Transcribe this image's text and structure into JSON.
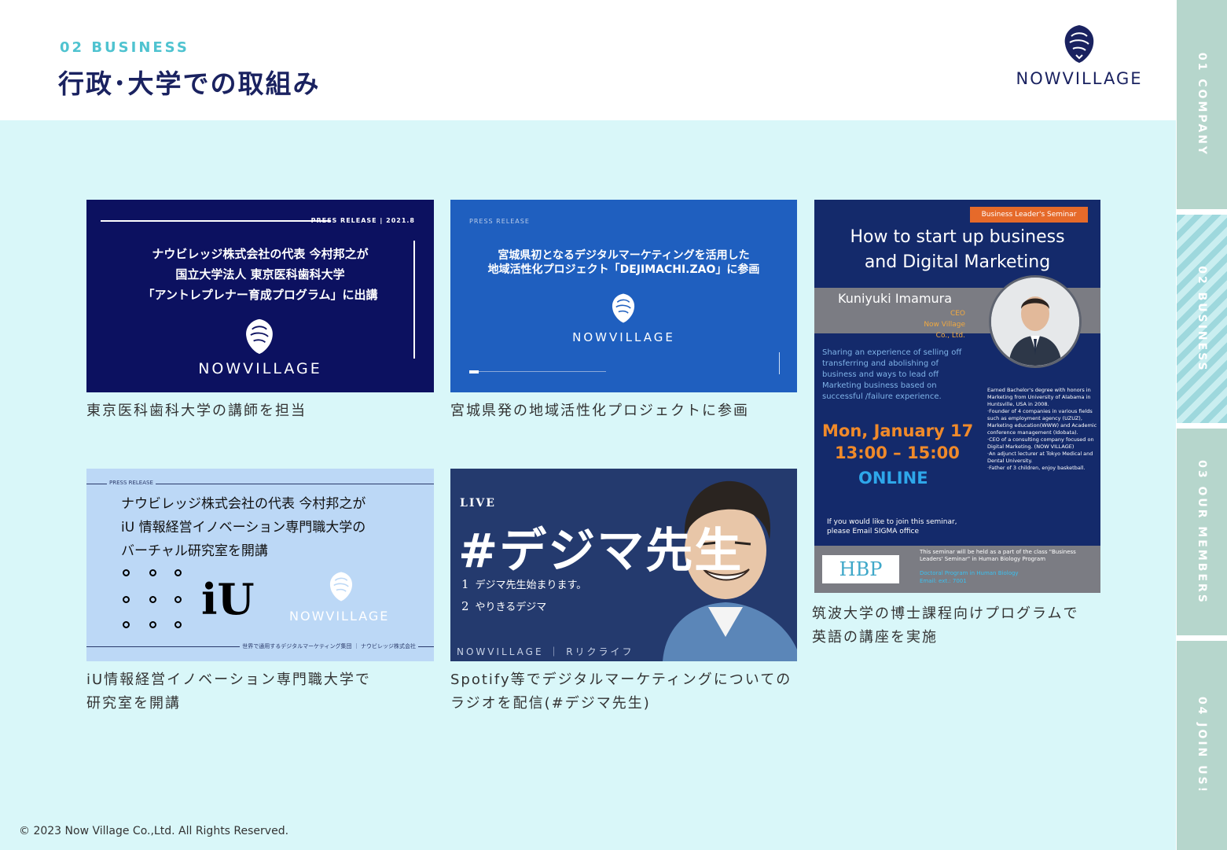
{
  "header": {
    "section_number": "02 BUSINESS",
    "title": "行政･大学での取組み",
    "logo_text": "NOWVILLAGE"
  },
  "cards": [
    {
      "pr_label": "PRESS RELEASE | 2021.8",
      "lines": [
        "ナウビレッジ株式会社の代表 今村邦之が",
        "国立大学法人 東京医科歯科大学",
        "「アントレプレナー育成プログラム」に出講"
      ],
      "brand": "NOWVILLAGE",
      "caption": [
        "東京医科歯科大学の講師を担当"
      ]
    },
    {
      "pr_label": "PRESS RELEASE",
      "lines": [
        "宮城県初となるデジタルマーケティングを活用した",
        "地域活性化プロジェクト「DEJIMACHI.ZAO」に参画"
      ],
      "brand": "NOWVILLAGE",
      "caption": [
        "宮城県発の地域活性化プロジェクトに参画"
      ]
    },
    {
      "badge": "Business Leader's Seminar",
      "title_lines": [
        "How to start up business",
        "and Digital Marketing"
      ],
      "name": "Kuniyuki Imamura",
      "role": "CEO",
      "company": "Now Village Co., Ltd.",
      "sharing": "Sharing an experience of selling off transferring and abolishing of business and ways to lead off Marketing business based on successful /failure experience.",
      "bio_lines": [
        "Earned Bachelor's degree with honors in Marketing from University of Alabama in Huntsville, USA in 2008.",
        "·Founder of 4 companies in various fields such as employment agency (UZUZ), Marketing education(WWW) and Academic conference management (Idobata).",
        "·CEO of a consulting company focused on Digital Marketing. (NOW VILLAGE)",
        "·An adjunct lecturer at Tokyo Medical and Dental University.",
        "·Father of 3 children, enjoy basketball."
      ],
      "date": "Mon, January 17",
      "time": "13:00 – 15:00",
      "online": "ONLINE",
      "join_lines": [
        "If you would like to join this seminar,",
        "please Email SIGMA office"
      ],
      "hbp": "HBP",
      "bottom_note": "This seminar will be held as a part of the class \"Business Leaders' Seminar\" in Human Biology Program",
      "bottom_doc": "Doctoral Program in Human Biology",
      "bottom_email": "Email: ext.: 7001",
      "caption": [
        "筑波大学の博士課程向けプログラムで",
        "英語の講座を実施"
      ]
    },
    {
      "pr_label": "PRESS RELEASE",
      "lines": [
        "ナウビレッジ株式会社の代表 今村邦之が",
        "iU 情報経営イノベーション専門職大学の",
        "バーチャル研究室を開講"
      ],
      "iu": "iU",
      "brand": "NOWVILLAGE",
      "footnote": "世界で通用するデジタルマーケティング集団 ｜ ナウビレッジ株式会社",
      "caption": [
        "iU情報経営イノベーション専門職大学で",
        "研究室を開講"
      ]
    },
    {
      "live": "LIVE",
      "headline": "#デジマ先生",
      "items": [
        {
          "n": "1",
          "text": "デジマ先生始まります。"
        },
        {
          "n": "2",
          "text": "やりきるデジマ"
        }
      ],
      "footer": "NOWVILLAGE ｜ Rリクライフ",
      "caption": [
        "Spotify等でデジタルマーケティングについての",
        "ラジオを配信(#デジマ先生)"
      ]
    }
  ],
  "side_nav": [
    {
      "label": "01 COMPANY",
      "active": false
    },
    {
      "label": "02 BUSINESS",
      "active": true
    },
    {
      "label": "03 OUR MEMBERS",
      "active": false
    },
    {
      "label": "04 JOIN US!",
      "active": false
    }
  ],
  "colors": {
    "accent": "#4fc3d0",
    "navy": "#1a2260",
    "background": "#d9f7f9",
    "side_tab": "#b6d6cc"
  },
  "footer": {
    "copyright": "© 2023  Now Village Co.,Ltd. All Rights Reserved."
  }
}
